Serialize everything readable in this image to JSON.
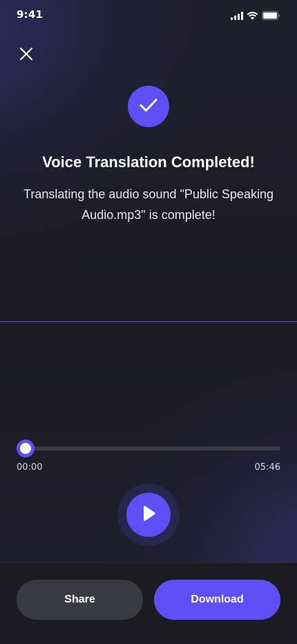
{
  "status_bar": {
    "time": "9:41"
  },
  "icons": {
    "close": "close-icon",
    "check": "check-icon",
    "play": "play-icon",
    "signal": "cellular-signal-icon",
    "wifi": "wifi-icon",
    "battery": "battery-icon"
  },
  "colors": {
    "accent": "#5b4ff5",
    "background": "#1d1c26",
    "share_button": "#3a3a42"
  },
  "completion": {
    "title": "Voice Translation Completed!",
    "message": "Translating the audio sound \"Public Speaking Audio.mp3\" is complete!"
  },
  "player": {
    "current_time": "00:00",
    "total_time": "05:46",
    "progress": 0.0
  },
  "actions": {
    "share_label": "Share",
    "download_label": "Download"
  }
}
